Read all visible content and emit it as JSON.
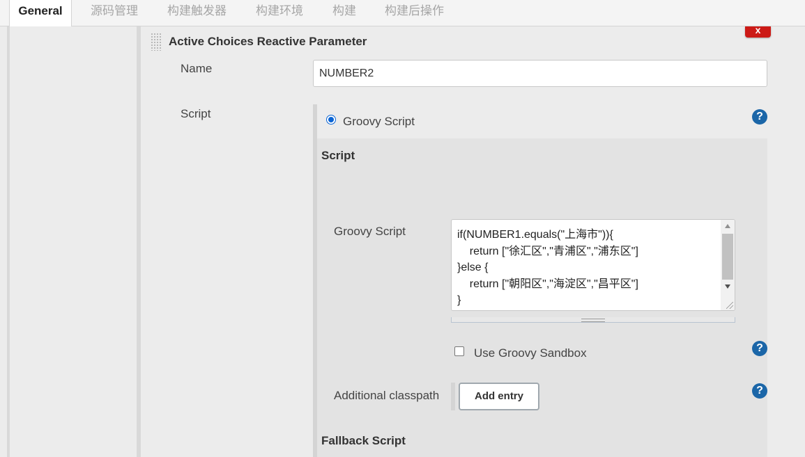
{
  "tabs": [
    {
      "label": "General",
      "active": true
    },
    {
      "label": "源码管理",
      "active": false
    },
    {
      "label": "构建触发器",
      "active": false
    },
    {
      "label": "构建环境",
      "active": false
    },
    {
      "label": "构建",
      "active": false
    },
    {
      "label": "构建后操作",
      "active": false
    }
  ],
  "parameter": {
    "title": "Active Choices Reactive Parameter",
    "delete_label": "x",
    "name_label": "Name",
    "name_value": "NUMBER2",
    "script_label": "Script"
  },
  "script": {
    "radio_label": "Groovy Script",
    "radio_checked": true,
    "section_title": "Script",
    "groovy_label": "Groovy Script",
    "code": "if(NUMBER1.equals(\"上海市\")){\n    return [\"徐汇区\",\"青浦区\",\"浦东区\"]\n}else {\n    return [\"朝阳区\",\"海淀区\",\"昌平区\"]\n}",
    "sandbox_label": "Use Groovy Sandbox",
    "sandbox_checked": false,
    "classpath_label": "Additional classpath",
    "add_entry_label": "Add entry",
    "fallback_title": "Fallback Script"
  },
  "help_glyph": "?",
  "colors": {
    "help_icon": "#1b66a8",
    "delete_button": "#cc1a16",
    "radio_accent": "#0a64d4"
  }
}
